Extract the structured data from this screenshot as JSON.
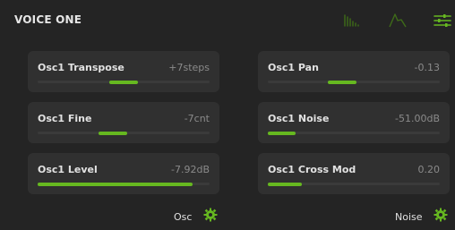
{
  "header": {
    "title": "VOICE ONE",
    "icons": [
      "bars-icon",
      "envelope-icon",
      "sliders-icon"
    ]
  },
  "colors": {
    "accent": "#66b820",
    "accent_dim": "#3e6b18",
    "card_bg": "#303030",
    "page_bg": "#242424"
  },
  "params": [
    {
      "label": "Osc1 Transpose",
      "value": "+7steps",
      "position": 0.5,
      "center": 0.5
    },
    {
      "label": "Osc1 Pan",
      "value": "-0.13",
      "position": 0.43,
      "center": 0.5
    },
    {
      "label": "Osc1 Fine",
      "value": "-7cnt",
      "position": 0.44,
      "center": 0.5
    },
    {
      "label": "Osc1 Noise",
      "value": "-51.00dB",
      "position": 0.16,
      "center": 0.0
    },
    {
      "label": "Osc1 Level",
      "value": "-7.92dB",
      "position": 0.9,
      "center": 0.0
    },
    {
      "label": "Osc1 Cross Mod",
      "value": "0.20",
      "position": 0.2,
      "center": 0.0
    }
  ],
  "footer": {
    "left": {
      "label": "Osc",
      "icon": "gear-icon"
    },
    "right": {
      "label": "Noise",
      "icon": "gear-icon"
    }
  }
}
